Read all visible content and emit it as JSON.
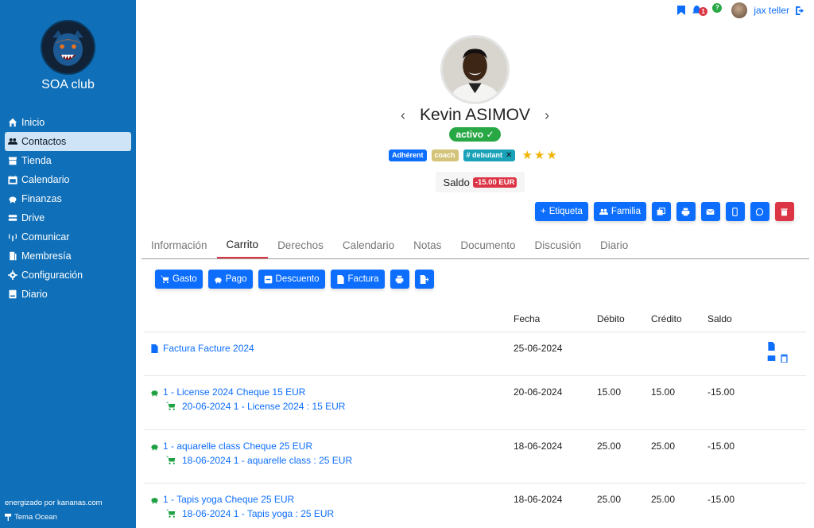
{
  "app": {
    "club_name": "SOA club",
    "credit": "energizado por kananas.com",
    "theme": "Tema Ocean"
  },
  "sidebar": {
    "items": [
      {
        "label": "Inicio",
        "icon": "home-icon"
      },
      {
        "label": "Contactos",
        "icon": "users-icon",
        "active": true
      },
      {
        "label": "Tienda",
        "icon": "store-icon"
      },
      {
        "label": "Calendario",
        "icon": "calendar-icon"
      },
      {
        "label": "Finanzas",
        "icon": "piggy-bank-icon"
      },
      {
        "label": "Drive",
        "icon": "drive-icon"
      },
      {
        "label": "Comunicar",
        "icon": "broadcast-icon"
      },
      {
        "label": "Membresía",
        "icon": "door-icon"
      },
      {
        "label": "Configuración",
        "icon": "gear-icon"
      },
      {
        "label": "Diario",
        "icon": "book-icon"
      }
    ]
  },
  "topbar": {
    "notifications": "1",
    "help": "?",
    "user_name": "jax teller"
  },
  "profile": {
    "name": "Kevin ASIMOV",
    "status": "activo ✓",
    "tags": [
      "Adhérent",
      "coach",
      "# debutant"
    ],
    "stars": "★★★",
    "saldo_label": "Saldo",
    "saldo_value": "-15.00 EUR"
  },
  "actions": {
    "etiqueta": "Etiqueta",
    "familia": "Familia"
  },
  "tabs": [
    "Información",
    "Carrito",
    "Derechos",
    "Calendario",
    "Notas",
    "Documento",
    "Discusión",
    "Diario"
  ],
  "cart_buttons": {
    "gasto": "Gasto",
    "pago": "Pago",
    "descuento": "Descuento",
    "factura": "Factura"
  },
  "table": {
    "headers": {
      "fecha": "Fecha",
      "debito": "Débito",
      "credito": "Crédito",
      "saldo": "Saldo"
    },
    "rows": [
      {
        "title": "Factura Facture 2024",
        "sub": "",
        "fecha": "25-06-2024",
        "debito": "",
        "credito": "",
        "saldo": ""
      },
      {
        "title": "1 - License 2024 Cheque 15 EUR",
        "sub": "20-06-2024 1 - License 2024 : 15 EUR",
        "fecha": "20-06-2024",
        "debito": "15.00",
        "credito": "15.00",
        "saldo": "-15.00"
      },
      {
        "title": "1 - aquarelle class Cheque 25 EUR",
        "sub": "18-06-2024 1 - aquarelle class : 25 EUR",
        "fecha": "18-06-2024",
        "debito": "25.00",
        "credito": "25.00",
        "saldo": "-15.00"
      },
      {
        "title": "1 - Tapis yoga Cheque 25 EUR",
        "sub": "18-06-2024 1 - Tapis yoga : 25 EUR",
        "fecha": "18-06-2024",
        "debito": "25.00",
        "credito": "25.00",
        "saldo": "-15.00"
      }
    ]
  }
}
